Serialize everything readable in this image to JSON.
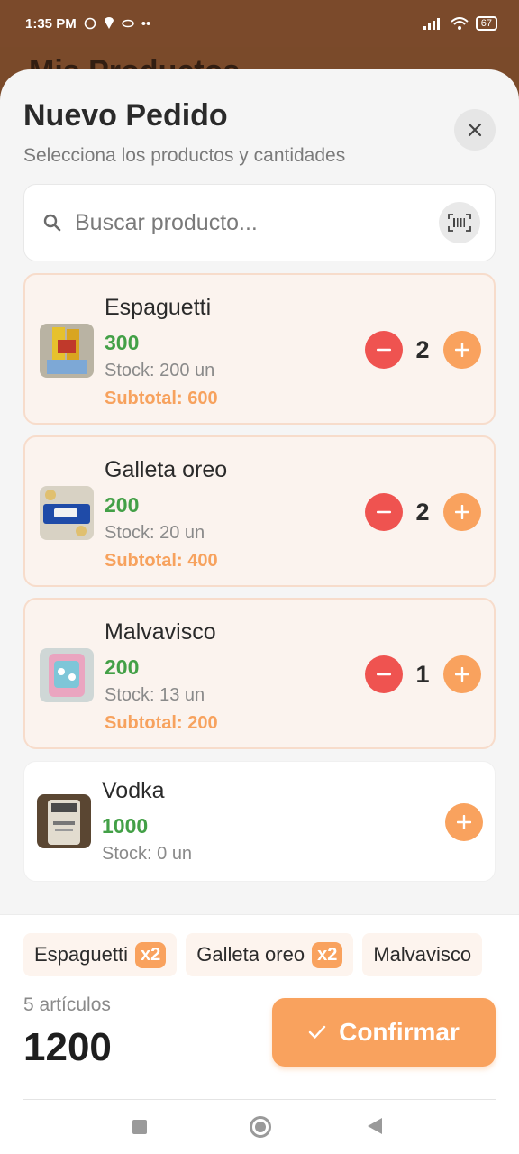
{
  "status_bar": {
    "time": "1:35 PM",
    "battery": "67"
  },
  "background_title": "Mis Productos",
  "sheet": {
    "title": "Nuevo Pedido",
    "subtitle": "Selecciona los productos y cantidades",
    "close_icon": "close-icon"
  },
  "search": {
    "placeholder": "Buscar producto...",
    "icon": "search-icon",
    "scan_icon": "barcode-scan-icon"
  },
  "products": [
    {
      "name": "Espaguetti",
      "price": "300",
      "stock": "Stock: 200 un",
      "quantity": "2",
      "subtotal": "Subtotal: 600"
    },
    {
      "name": "Galleta oreo",
      "price": "200",
      "stock": "Stock: 20 un",
      "quantity": "2",
      "subtotal": "Subtotal: 400"
    },
    {
      "name": "Malvavisco",
      "price": "200",
      "stock": "Stock: 13 un",
      "quantity": "1",
      "subtotal": "Subtotal: 200"
    },
    {
      "name": "Vodka",
      "price": "1000",
      "stock": "Stock: 0 un"
    }
  ],
  "summary": {
    "chips": [
      {
        "name": "Espaguetti",
        "badge": "x2"
      },
      {
        "name": "Galleta oreo",
        "badge": "x2"
      },
      {
        "name": "Malvavisco"
      }
    ],
    "items_count": "5 artículos",
    "total": "1200",
    "confirm_label": "Confirmar"
  },
  "colors": {
    "accent": "#f9a25e",
    "price_green": "#43a047",
    "minus_red": "#ef5350",
    "card_highlight": "#fbf3ee"
  }
}
